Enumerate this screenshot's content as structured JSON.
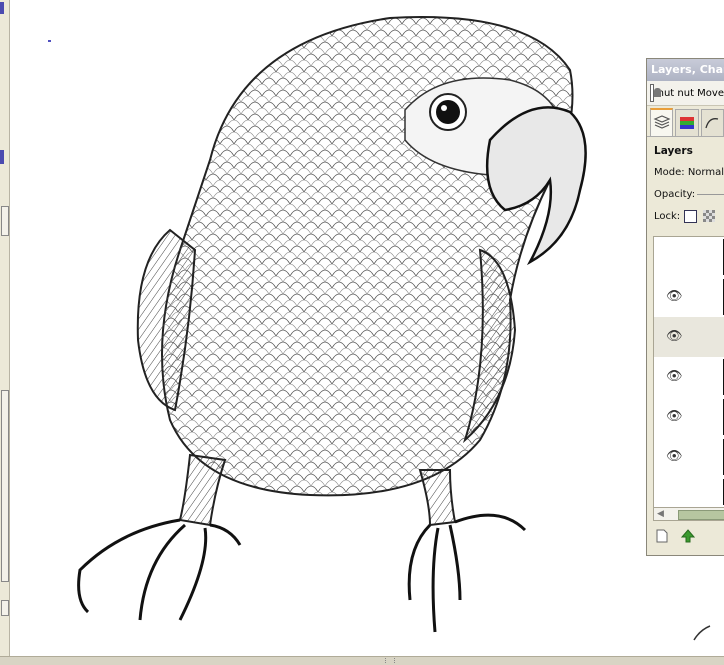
{
  "dock": {
    "title": "Layers, Chann",
    "image_menu_label": "nut nut Move",
    "tabs": [
      {
        "icon": "layers-icon"
      },
      {
        "icon": "channels-icon"
      },
      {
        "icon": "paths-icon"
      }
    ],
    "panel_title": "Layers",
    "mode_label": "Mode:",
    "mode_value": "Normal",
    "opacity_label": "Opacity:",
    "lock_label": "Lock:",
    "layers": [
      {
        "visible": false
      },
      {
        "visible": true
      },
      {
        "visible": true
      },
      {
        "visible": true
      },
      {
        "visible": true
      },
      {
        "visible": true
      }
    ],
    "buttons": [
      {
        "icon": "new-layer-icon"
      },
      {
        "icon": "raise-layer-icon"
      }
    ]
  },
  "canvas": {
    "content": "pencil-sketch-parrot"
  }
}
